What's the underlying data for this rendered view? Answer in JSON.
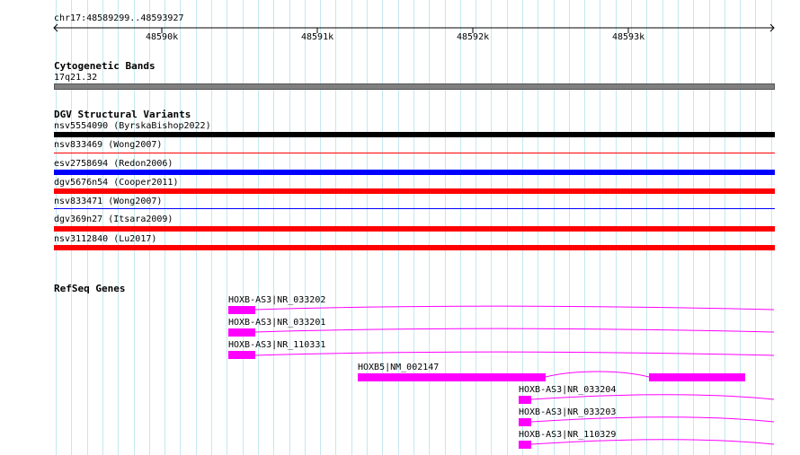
{
  "ruler": {
    "position": "chr17:48589299..48593927",
    "ticks": [
      "48590k",
      "48591k",
      "48592k",
      "48593k"
    ]
  },
  "cytoband": {
    "title": "Cytogenetic Bands",
    "band": "17q21.32",
    "color": "#7f7f7f"
  },
  "dgv": {
    "title": "DGV Structural Variants",
    "variants": [
      {
        "label": "nsv5554090 (ByrskaBishop2022)",
        "color": "#000000"
      },
      {
        "label": "nsv833469 (Wong2007)",
        "color": "#ff0000"
      },
      {
        "label": "esv2758694 (Redon2006)",
        "color": "#0000ff"
      },
      {
        "label": "dgv5676n54 (Cooper2011)",
        "color": "#ff0000"
      },
      {
        "label": "nsv833471 (Wong2007)",
        "color": "#0000ff"
      },
      {
        "label": "dgv369n27 (Itsara2009)",
        "color": "#ff0000"
      },
      {
        "label": "nsv3112840 (Lu2017)",
        "color": "#ff0000"
      }
    ]
  },
  "refseq": {
    "title": "RefSeq Genes",
    "color": "#ff00ff",
    "genes": [
      {
        "label": "HOXB-AS3|NR_033202"
      },
      {
        "label": "HOXB-AS3|NR_033201"
      },
      {
        "label": "HOXB-AS3|NR_110331"
      },
      {
        "label": "HOXB5|NM_002147"
      },
      {
        "label": "HOXB-AS3|NR_033204"
      },
      {
        "label": "HOXB-AS3|NR_033203"
      },
      {
        "label": "HOXB-AS3|NR_110329"
      }
    ]
  }
}
